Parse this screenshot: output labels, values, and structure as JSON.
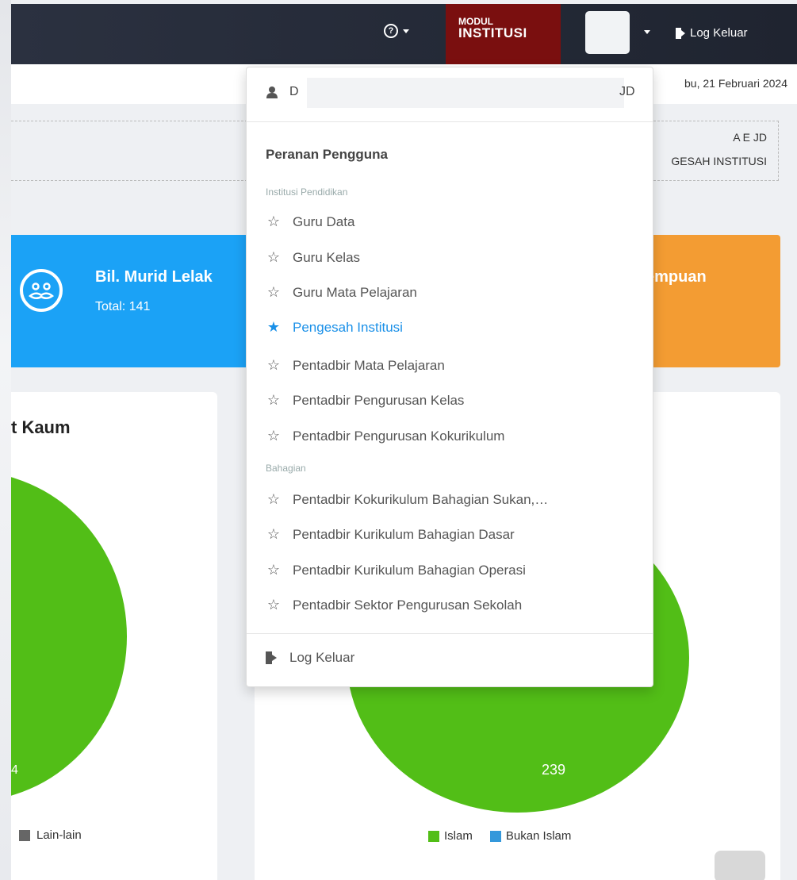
{
  "topbar": {
    "help_icon": "question-circle-icon",
    "modul_small": "MODUL",
    "modul_big": "INSTITUSI",
    "logout_label": "Log Keluar"
  },
  "datebar": {
    "date": "bu, 21 Februari 2024"
  },
  "info_box": {
    "line1": "A E          JD",
    "line2": "GESAH INSTITUSI"
  },
  "cards": {
    "male": {
      "title": "Bil. Murid Lelak",
      "total": "Total: 141",
      "icon": "mustache-face-icon",
      "color": "#1ba2f6"
    },
    "female": {
      "title": "empuan",
      "color": "#f39c33"
    }
  },
  "panels": {
    "left": {
      "title": "t Kaum",
      "pie_label": "4",
      "legend": [
        {
          "label": "Lain-lain",
          "color": "#666666"
        }
      ]
    },
    "right": {
      "pie_label": "239",
      "legend": [
        {
          "label": "Islam",
          "color": "#52be17"
        },
        {
          "label": "Bukan Islam",
          "color": "#3498db"
        }
      ]
    }
  },
  "dropdown": {
    "user_initial": "D",
    "user_suffix": "JD",
    "heading": "Peranan Pengguna",
    "groups": [
      {
        "label": "Institusi Pendidikan",
        "items": [
          {
            "label": "Guru Data",
            "active": false
          },
          {
            "label": "Guru Kelas",
            "active": false
          },
          {
            "label": "Guru Mata Pelajaran",
            "active": false
          },
          {
            "label": "Pengesah Institusi",
            "active": true
          },
          {
            "label": "Pentadbir Mata Pelajaran",
            "active": false
          },
          {
            "label": "Pentadbir Pengurusan Kelas",
            "active": false
          },
          {
            "label": "Pentadbir Pengurusan Kokurikulum",
            "active": false
          }
        ]
      },
      {
        "label": "Bahagian",
        "items": [
          {
            "label": "Pentadbir Kokurikulum Bahagian Sukan,…",
            "active": false
          },
          {
            "label": "Pentadbir Kurikulum Bahagian Dasar",
            "active": false
          },
          {
            "label": "Pentadbir Kurikulum Bahagian Operasi",
            "active": false
          },
          {
            "label": "Pentadbir Sektor Pengurusan Sekolah",
            "active": false
          }
        ]
      }
    ],
    "logout_label": "Log Keluar"
  },
  "colors": {
    "accent": "#1a90e8",
    "topbar": "#1f2430",
    "modul": "#7a0f0f",
    "pie": "#52be17"
  }
}
